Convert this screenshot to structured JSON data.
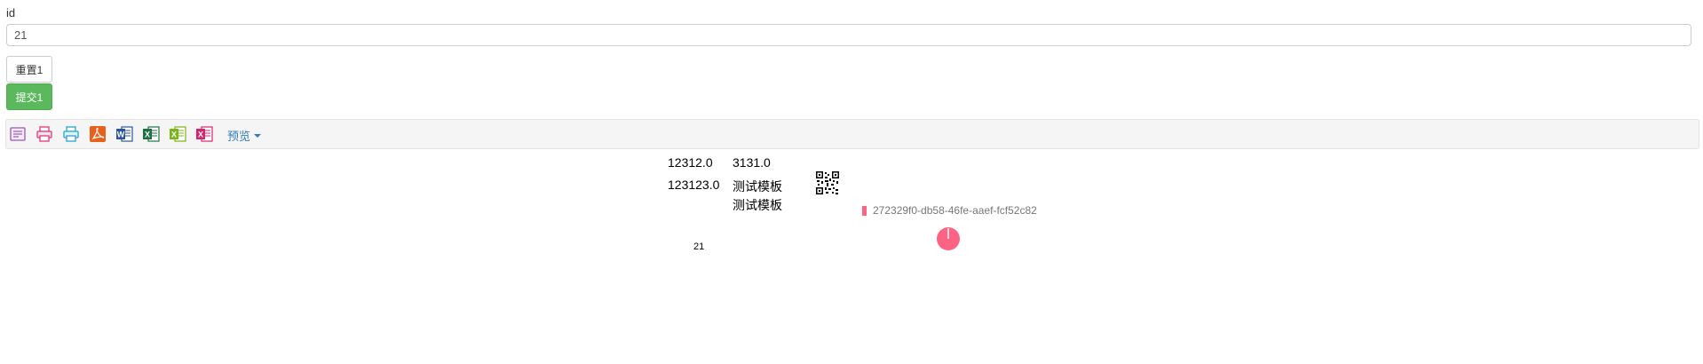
{
  "form": {
    "id_label": "id",
    "id_value": "21",
    "reset_label": "重置1",
    "submit_label": "提交1"
  },
  "toolbar": {
    "icons": [
      "design-icon",
      "print-icon",
      "print-preview-icon",
      "pdf-icon",
      "word-icon",
      "excel-icon",
      "excel-alt-icon",
      "excel-export-icon"
    ],
    "preview_label": "预览"
  },
  "report": {
    "cell_r1c1": "12312.0",
    "cell_r1c2": "3131.0",
    "cell_r2c1": "123123.0",
    "cell_r2c2": "测试模板",
    "cell_r3c2": "测试模板",
    "uuid": "272329f0-db58-46fe-aaef-fcf52c82",
    "id_value": "21",
    "accent_color": "#ff6384",
    "chart_fraction": 1.0
  }
}
